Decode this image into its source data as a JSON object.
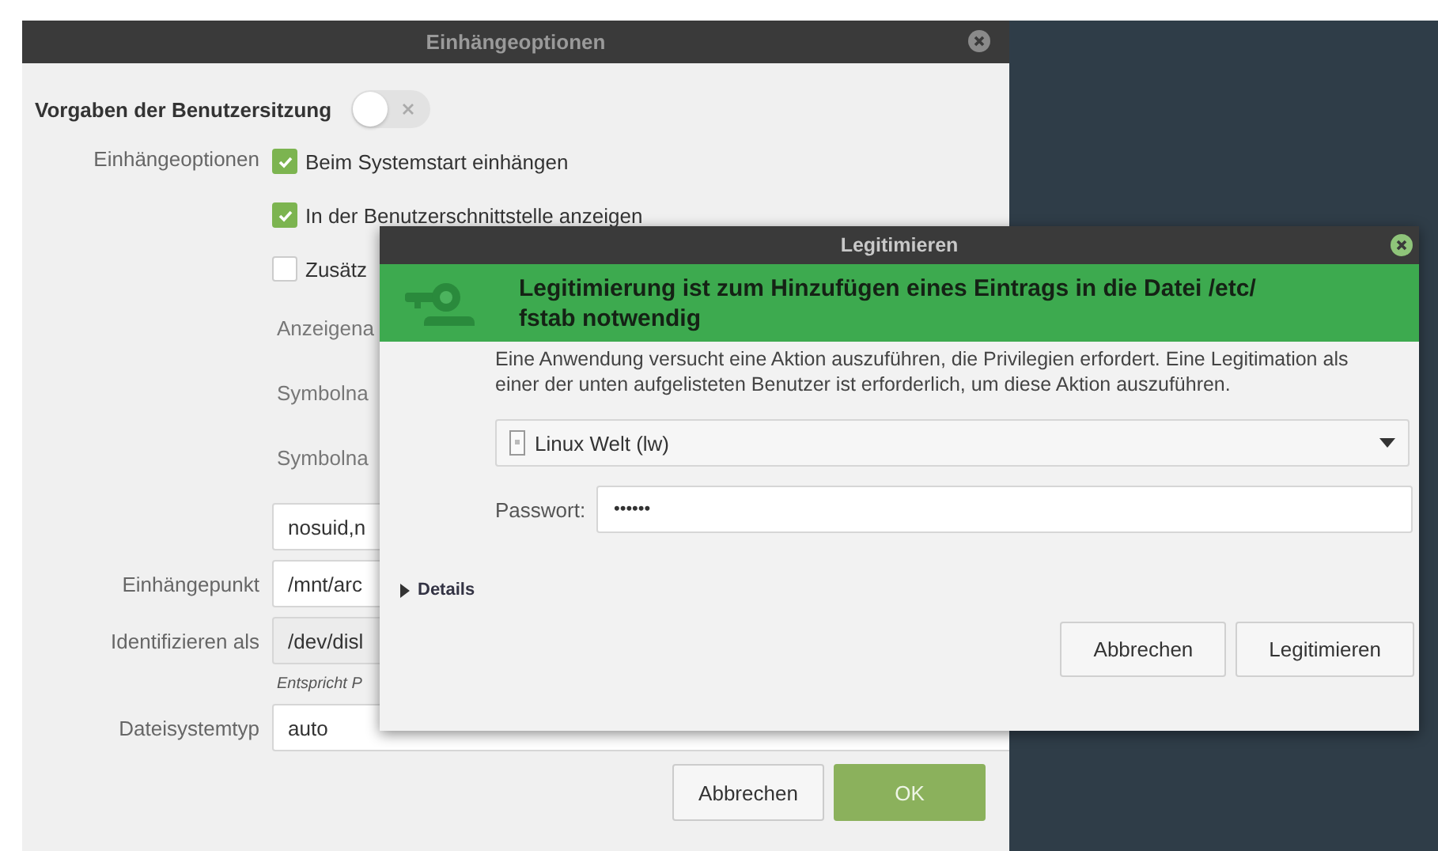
{
  "main_window": {
    "title": "Einhängeoptionen",
    "session_defaults": {
      "label": "Vorgaben der Benutzersitzung",
      "on": false
    },
    "mount_options_label": "Einhängeoptionen",
    "options": [
      {
        "label": "Beim Systemstart einhängen",
        "checked": true
      },
      {
        "label": "In der Benutzerschnittstelle anzeigen",
        "checked": true
      },
      {
        "label": "Zusätz",
        "checked": false
      }
    ],
    "partial_labels": [
      "Anzeigena",
      "Symbolna",
      "Symbolna"
    ],
    "options_field": {
      "value": "nosuid,n"
    },
    "fields": [
      {
        "label": "Einhängepunkt",
        "value": "/mnt/arc",
        "disabled": false
      },
      {
        "label": "Identifizieren als",
        "value": "/dev/disl",
        "disabled": true
      }
    ],
    "hint": "Entspricht P",
    "filesystem": {
      "label": "Dateisystemtyp",
      "value": "auto"
    },
    "buttons": [
      {
        "label": "Abbrechen",
        "kind": "default"
      },
      {
        "label": "OK",
        "kind": "primary"
      }
    ]
  },
  "auth_dialog": {
    "title": "Legitimieren",
    "heading": "Legitimierung ist zum Hinzufügen eines Eintrags in die Datei /etc/ fstab notwendig",
    "message": "Eine Anwendung versucht eine Aktion auszuführen, die Privilegien erfordert. Eine Legitimation als einer der unten aufgelisteten Benutzer ist erforderlich, um diese Aktion auszuführen.",
    "user": {
      "value": "Linux Welt (lw)"
    },
    "password": {
      "label": "Passwort:",
      "value": "••••••"
    },
    "details": {
      "label": "Details",
      "expanded": false
    },
    "buttons": [
      {
        "label": "Abbrechen"
      },
      {
        "label": "Legitimieren"
      }
    ]
  }
}
